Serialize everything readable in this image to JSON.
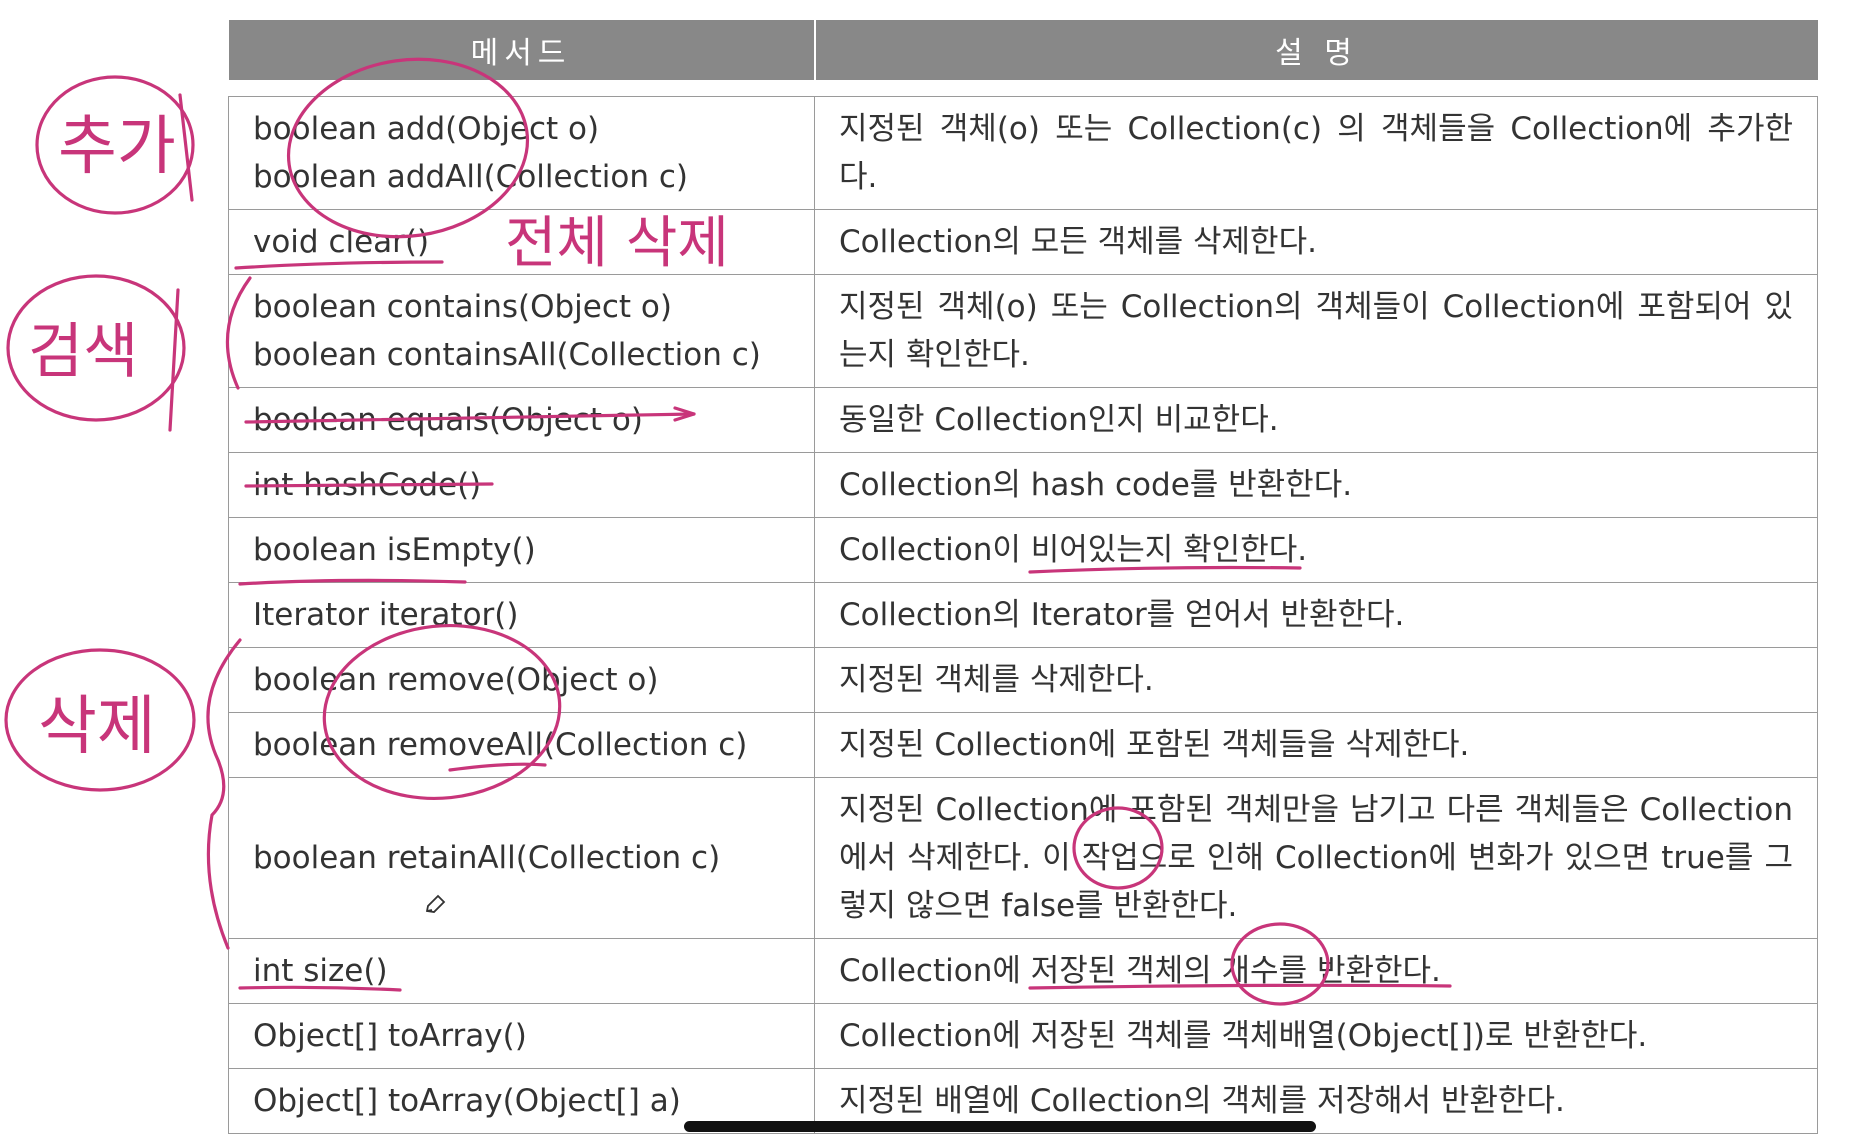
{
  "table": {
    "headers": [
      "메서드",
      "설 명"
    ],
    "rows": [
      {
        "method": [
          "boolean add(Object o)",
          "boolean addAll(Collection c)"
        ],
        "desc": "지정된 객체(o) 또는 Collection(c) 의 객체들을 Collection에 추가한다."
      },
      {
        "method": [
          "void clear()"
        ],
        "desc": "Collection의 모든 객체를 삭제한다."
      },
      {
        "method": [
          "boolean contains(Object o)",
          "boolean containsAll(Collection c)"
        ],
        "desc": "지정된 객체(o) 또는 Collection의 객체들이 Collection에 포함되어 있는지 확인한다."
      },
      {
        "method": [
          "boolean equals(Object o)"
        ],
        "desc": "동일한 Collection인지 비교한다."
      },
      {
        "method": [
          "int hashCode()"
        ],
        "desc": "Collection의 hash code를 반환한다."
      },
      {
        "method": [
          "boolean isEmpty()"
        ],
        "desc": "Collection이 비어있는지 확인한다."
      },
      {
        "method": [
          "Iterator iterator()"
        ],
        "desc": "Collection의 Iterator를 얻어서 반환한다."
      },
      {
        "method": [
          "boolean remove(Object o)"
        ],
        "desc": "지정된 객체를 삭제한다."
      },
      {
        "method": [
          "boolean removeAll(Collection c)"
        ],
        "desc": "지정된 Collection에 포함된 객체들을 삭제한다."
      },
      {
        "method": [
          "boolean retainAll(Collection c)"
        ],
        "desc": "지정된 Collection에 포함된 객체만을 남기고 다른 객체들은 Collection 에서 삭제한다. 이 작업으로 인해 Collection에 변화가 있으면 true를 그렇지 않으면 false를 반환한다."
      },
      {
        "method": [
          "int size()"
        ],
        "desc": "Collection에 저장된 객체의 개수를 반환한다."
      },
      {
        "method": [
          "Object[] toArray()"
        ],
        "desc": "Collection에 저장된 객체를 객체배열(Object[])로 반환한다."
      },
      {
        "method": [
          "Object[] toArray(Object[] a)"
        ],
        "desc": "지정된 배열에 Collection의 객체를 저장해서 반환한다."
      }
    ]
  },
  "annotations": {
    "add": "추가",
    "clear_all": "전체 삭제",
    "search": "검색",
    "delete": "삭제"
  },
  "colors": {
    "header_bg": "#888888",
    "ink": "#c8357a",
    "border": "#9a9a9a"
  },
  "icons": [
    "pencil-cursor-icon"
  ]
}
